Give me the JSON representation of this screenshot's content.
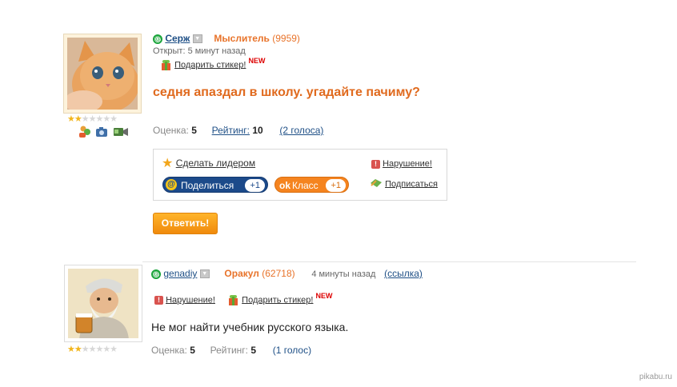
{
  "post": {
    "author": "Серж",
    "rank": "Мыслитель",
    "points": "(9959)",
    "opened": "Открыт: 5 минут назад",
    "gift_label": "Подарить стикер!",
    "new_badge": "NEW",
    "question": "седня апаздал в школу. угадайте пачиму?",
    "rating": {
      "score_label": "Оценка:",
      "score": "5",
      "rating_label": "Рейтинг:",
      "rating": "10",
      "votes": "(2 голоса)"
    },
    "stars": {
      "filled": 2,
      "total": 7
    },
    "actions": {
      "make_leader": "Сделать лидером",
      "violation": "Нарушение!",
      "subscribe": "Подписаться",
      "share": "Поделиться",
      "share_count": "+1",
      "klass": "Класс",
      "klass_count": "+1"
    },
    "reply_button": "Ответить!"
  },
  "answer": {
    "author": "genadiy",
    "rank": "Оракул",
    "points": "(62718)",
    "time": "4 минуты назад",
    "link_label": "(ссылка)",
    "violation": "Нарушение!",
    "gift_label": "Подарить стикер!",
    "new_badge": "NEW",
    "text": "Не мог найти учебник русского языка.",
    "rating": {
      "score_label": "Оценка:",
      "score": "5",
      "rating_label": "Рейтинг:",
      "rating": "5",
      "votes": "(1 голос)"
    },
    "stars": {
      "filled": 2,
      "total": 7
    }
  },
  "watermark": "pikabu.ru",
  "colors": {
    "rank": "#e8732a",
    "link": "#1e4f86",
    "question": "#e06a1e",
    "reply": "#f08a0c",
    "share": "#1c4a8a",
    "klass": "#f5841f"
  }
}
